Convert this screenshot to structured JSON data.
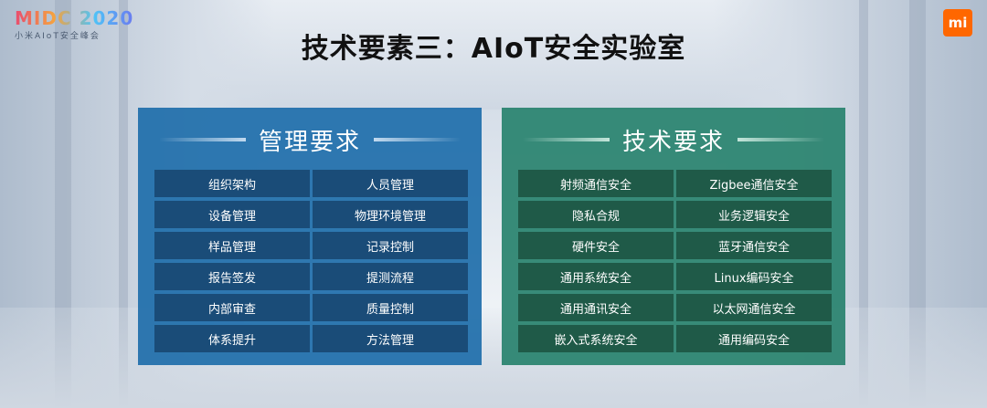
{
  "logo": {
    "main": "MIDC 2020",
    "sub": "小米AIoT安全峰会"
  },
  "brand_badge": "mi",
  "title": "技术要素三：AIoT安全实验室",
  "colors": {
    "left_panel": "#1e6eaa",
    "right_panel": "#28826e"
  },
  "management": {
    "title": "管理要求",
    "items": [
      "组织架构",
      "人员管理",
      "设备管理",
      "物理环境管理",
      "样品管理",
      "记录控制",
      "报告签发",
      "提测流程",
      "内部审查",
      "质量控制",
      "体系提升",
      "方法管理"
    ]
  },
  "technical": {
    "title": "技术要求",
    "items": [
      "射频通信安全",
      "Zigbee通信安全",
      "隐私合规",
      "业务逻辑安全",
      "硬件安全",
      "蓝牙通信安全",
      "通用系统安全",
      "Linux编码安全",
      "通用通讯安全",
      "以太网通信安全",
      "嵌入式系统安全",
      "通用编码安全"
    ]
  }
}
